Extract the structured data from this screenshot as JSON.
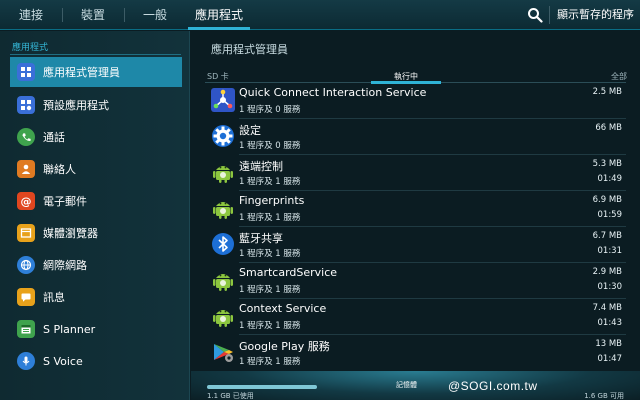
{
  "top_tabs": [
    {
      "label": "連接"
    },
    {
      "label": "裝置"
    },
    {
      "label": "一般"
    },
    {
      "label": "應用程式"
    }
  ],
  "top_actions": {
    "search_icon": "search-icon",
    "show_cached": "顯示暫存的程序"
  },
  "sidebar": {
    "section_title": "應用程式",
    "items": [
      {
        "label": "應用程式管理員",
        "icon": "grid-icon",
        "color": "#3a6fd8",
        "glyph": "▦"
      },
      {
        "label": "預設應用程式",
        "icon": "default-apps-icon",
        "color": "#3a6fd8",
        "glyph": "▦"
      },
      {
        "label": "通話",
        "icon": "phone-icon",
        "color": "#3fa34d",
        "glyph": "✆"
      },
      {
        "label": "聯絡人",
        "icon": "contacts-icon",
        "color": "#e07b22",
        "glyph": "👤"
      },
      {
        "label": "電子郵件",
        "icon": "email-icon",
        "color": "#e0461f",
        "glyph": "@"
      },
      {
        "label": "媒體瀏覽器",
        "icon": "browser-icon",
        "color": "#e8a21b",
        "glyph": "▤"
      },
      {
        "label": "網際網路",
        "icon": "internet-icon",
        "color": "#2e7fd8",
        "glyph": "◍"
      },
      {
        "label": "訊息",
        "icon": "messages-icon",
        "color": "#e8a21b",
        "glyph": "✉"
      },
      {
        "label": "S Planner",
        "icon": "planner-icon",
        "color": "#3fa34d",
        "glyph": "▥"
      },
      {
        "label": "S Voice",
        "icon": "microphone-icon",
        "color": "#2e7fd8",
        "glyph": "🎤"
      }
    ]
  },
  "main": {
    "title": "應用程式管理員",
    "sub_tabs": [
      {
        "label": "SD 卡"
      },
      {
        "label": "執行中"
      },
      {
        "label": "全部"
      }
    ],
    "apps": [
      {
        "name": "Quick Connect Interaction Service",
        "procs": "1 程序及 0 服務",
        "size": "2.5 MB",
        "time": "",
        "icon": "quick-connect-icon"
      },
      {
        "name": "設定",
        "procs": "1 程序及 0 服務",
        "size": "66 MB",
        "time": "",
        "icon": "settings-gear-icon"
      },
      {
        "name": "遠端控制",
        "procs": "1 程序及 1 服務",
        "size": "5.3 MB",
        "time": "01:49",
        "icon": "android-icon"
      },
      {
        "name": "Fingerprints",
        "procs": "1 程序及 1 服務",
        "size": "6.9 MB",
        "time": "01:59",
        "icon": "android-icon"
      },
      {
        "name": "藍牙共享",
        "procs": "1 程序及 1 服務",
        "size": "6.7 MB",
        "time": "01:31",
        "icon": "bluetooth-icon"
      },
      {
        "name": "SmartcardService",
        "procs": "1 程序及 1 服務",
        "size": "2.9 MB",
        "time": "01:30",
        "icon": "android-icon"
      },
      {
        "name": "Context Service",
        "procs": "1 程序及 1 服務",
        "size": "7.4 MB",
        "time": "01:43",
        "icon": "android-icon"
      },
      {
        "name": "Google Play 服務",
        "procs": "1 程序及 1 服務",
        "size": "13 MB",
        "time": "01:47",
        "icon": "google-play-services-icon"
      }
    ],
    "memory": {
      "label": "記憶體",
      "used": "1.1 GB 已使用",
      "available": "1.6 GB 可用"
    }
  },
  "watermark": "@SOGI.com.tw",
  "colors": {
    "accent": "#2fb3d6",
    "selected": "#1e88a8",
    "background": "#0b1c22"
  }
}
